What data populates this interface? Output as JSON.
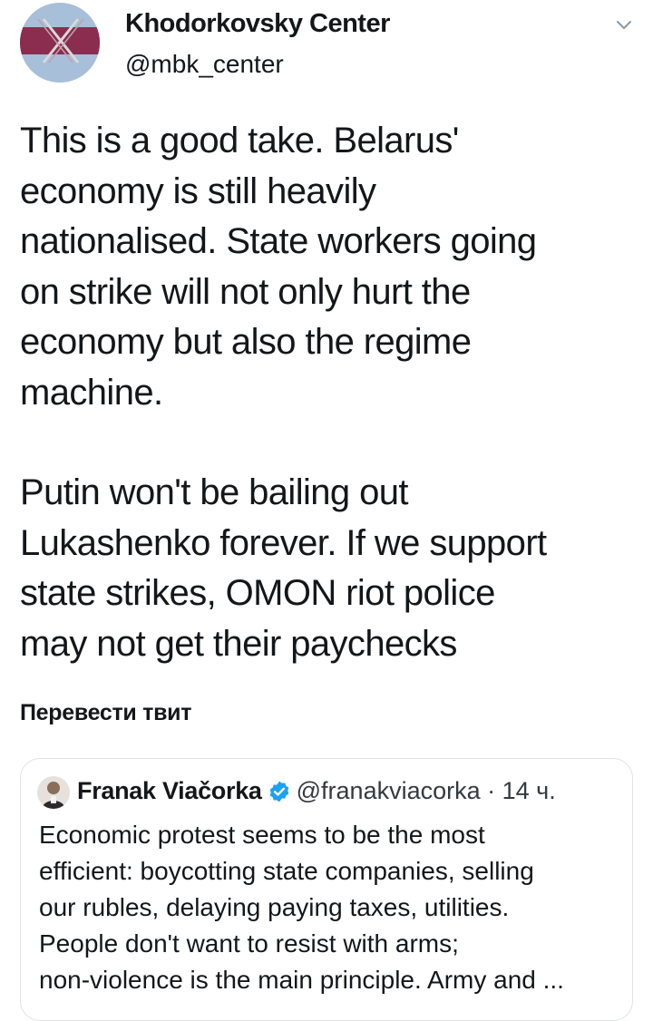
{
  "tweet": {
    "author": {
      "name": "Khodorkovsky Center",
      "handle": "@mbk_center"
    },
    "paragraphs": [
      "This is a good take. Belarus'\neconomy is still heavily\nnationalised. State workers going\non strike will not only hurt the\neconomy but also the regime\nmachine.",
      "Putin won't be bailing out\nLukashenko forever. If we support\nstate strikes, OMON riot police\nmay not get their paychecks"
    ],
    "translate_label": "Перевести твит",
    "quoted": {
      "name": "Franak Viačorka",
      "handle": "@franakviacorka",
      "separator": " · ",
      "time": "14 ч.",
      "text": "Economic protest seems to be the most\nefficient: boycotting state companies, selling\nour rubles, delaying paying taxes, utilities.\nPeople don't want to resist with arms;\nnon-violence is the main principle. Army and ..."
    }
  },
  "icons": {
    "caret": "chevron-down-icon",
    "verified": "verified-badge-icon"
  },
  "colors": {
    "text": "#14171a",
    "verified": "#1da1f2",
    "avatar_bg": "#a7bfd9",
    "avatar_band": "#8a2d4f",
    "border": "#dfe3e6"
  }
}
